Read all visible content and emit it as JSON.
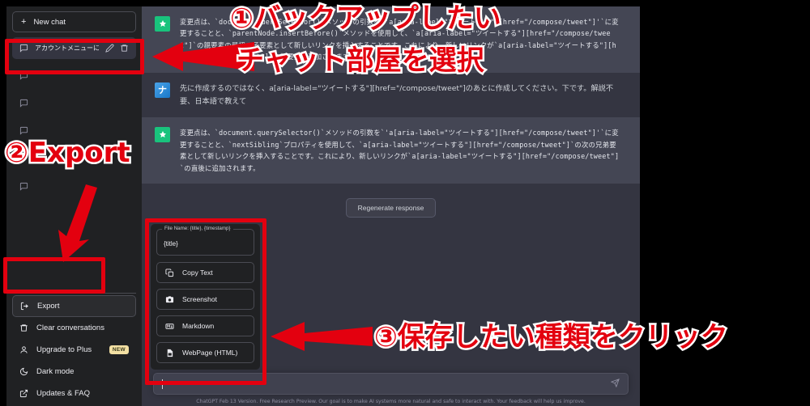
{
  "sidebar": {
    "new_chat_label": "New chat",
    "chats": [
      {
        "title": "アカウントメニューにリンク追",
        "active": true,
        "blank": false
      },
      {
        "title": "",
        "active": false,
        "blank": true
      },
      {
        "title": "",
        "active": false,
        "blank": true
      },
      {
        "title": "",
        "active": false,
        "blank": true
      },
      {
        "title": "",
        "active": false,
        "blank": true
      }
    ],
    "menu": [
      {
        "label": "Export",
        "icon": "export-icon",
        "highlight": true,
        "badge": ""
      },
      {
        "label": "Clear conversations",
        "icon": "trash-icon",
        "highlight": false,
        "badge": ""
      },
      {
        "label": "Upgrade to Plus",
        "icon": "user-icon",
        "highlight": false,
        "badge": "NEW"
      },
      {
        "label": "Dark mode",
        "icon": "moon-icon",
        "highlight": false,
        "badge": ""
      },
      {
        "label": "Updates & FAQ",
        "icon": "external-link-icon",
        "highlight": false,
        "badge": ""
      }
    ]
  },
  "export_popup": {
    "filename_label": "File Name: {title}, {timestamp}",
    "filename_value": "{title}",
    "items": [
      {
        "label": "Copy Text",
        "icon": "copy-icon"
      },
      {
        "label": "Screenshot",
        "icon": "camera-icon"
      },
      {
        "label": "Markdown",
        "icon": "markdown-icon"
      },
      {
        "label": "WebPage (HTML)",
        "icon": "file-html-icon"
      }
    ]
  },
  "chat": {
    "messages": [
      {
        "role": "assistant",
        "text": "変更点は、`document.querySelector()`メソッドの引数を`'a[aria-label=\"ツイートする\"][href=\"/compose/tweet\"]'`に変更することと、`parentNode.insertBefore()`メソッドを使用して、`a[aria-label=\"ツイートする\"][href=\"/compose/tweet\"]`の親要素の最初の子要素として新しいリンクを挿入することです。これにより、新しいリンクが`a[aria-label=\"ツイートする\"][href=\"/compose/tweet\"]`の親要素に追加されます。"
      },
      {
        "role": "user",
        "text": "先に作成するのではなく、a[aria-label=\"ツイートする\"][href=\"/compose/tweet\"]のあとに作成してください。下です。解説不要、日本語で教えて"
      },
      {
        "role": "assistant",
        "text": "変更点は、`document.querySelector()`メソッドの引数を`'a[aria-label=\"ツイートする\"][href=\"/compose/tweet\"]'`に変更することと、`nextSibling`プロパティを使用して、`a[aria-label=\"ツイートする\"][href=\"/compose/tweet\"]`の次の兄弟要素として新しいリンクを挿入することです。これにより、新しいリンクが`a[aria-label=\"ツイートする\"][href=\"/compose/tweet\"]`の直後に追加されます。"
      }
    ],
    "regenerate_label": "Regenerate response",
    "composer_value": "",
    "composer_placeholder": "",
    "footer_note": "ChatGPT Feb 13 Version. Free Research Preview. Our goal is to make AI systems more natural and safe to interact with. Your feedback will help us improve."
  },
  "annotations": {
    "step1": "①バックアップしたい\nチャット部屋を選択",
    "step1_line1": "①バックアップしたい",
    "step1_line2": "チャット部屋を選択",
    "step2": "②Export",
    "step3": "③保存したい種類をクリック"
  },
  "colors": {
    "accent_red": "#e3000f",
    "sidebar_bg": "#202123",
    "chat_bg": "#343541",
    "assistant_bg": "#444654",
    "badge_new": "#f3e0a3"
  }
}
